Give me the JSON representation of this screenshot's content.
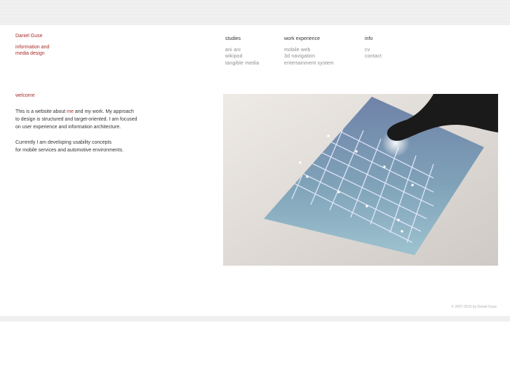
{
  "site": {
    "name": "Daniel Guse",
    "tagline_line1": "information and",
    "tagline_line2": "media design"
  },
  "nav": {
    "studies": {
      "heading": "studies",
      "items": [
        "ani ani",
        "wikipod",
        "tangible media"
      ]
    },
    "work": {
      "heading": "work experience",
      "items": [
        "mobile web",
        "3d navigation",
        "entertainment system"
      ]
    },
    "info": {
      "heading": "info",
      "items": [
        "cv",
        "contact"
      ]
    }
  },
  "welcome": {
    "title": "welcome",
    "p1_l1_before": "This is a website about ",
    "p1_l1_link": "me",
    "p1_l1_after": " and my work. My approach",
    "p1_l2": "to design is structured and target-oriented. I am focused",
    "p1_l3": "on user experience and information architecture.",
    "p2_l1": "Currently I am developing usability concepts",
    "p2_l2": "for mobile services and automotive environments."
  },
  "footer": {
    "copyright": "© 2007-2010 by Daniel Guse"
  },
  "colors": {
    "accent": "#a82a2a",
    "link_gray": "#8a8a8a",
    "text": "#333333"
  }
}
